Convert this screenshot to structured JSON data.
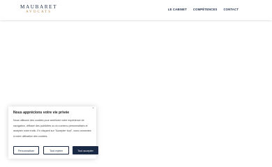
{
  "header": {
    "logo_name": "MAUBARET",
    "logo_sub": "AVOCATS",
    "nav": [
      {
        "label": "LE CABINET"
      },
      {
        "label": "COMPÉTENCES"
      },
      {
        "label": "CONTACT"
      }
    ]
  },
  "cookie": {
    "close": "×",
    "title": "Nous apprécions votre vie privée",
    "text": "Nous utilisons des cookies pour améliorer votre expérience de navigation, diffuser des publicités ou du contenu personnalisés et analyser notre trafic. En cliquant sur \"Accepter tout\", vous consentez à notre utilisation des cookies.",
    "btn_customize": "Personnaliser",
    "btn_reject": "Tout rejeter",
    "btn_accept": "Tout accepter"
  },
  "colors": {
    "brand_navy": "#1b2a44",
    "brand_gold": "#b08a4a"
  }
}
